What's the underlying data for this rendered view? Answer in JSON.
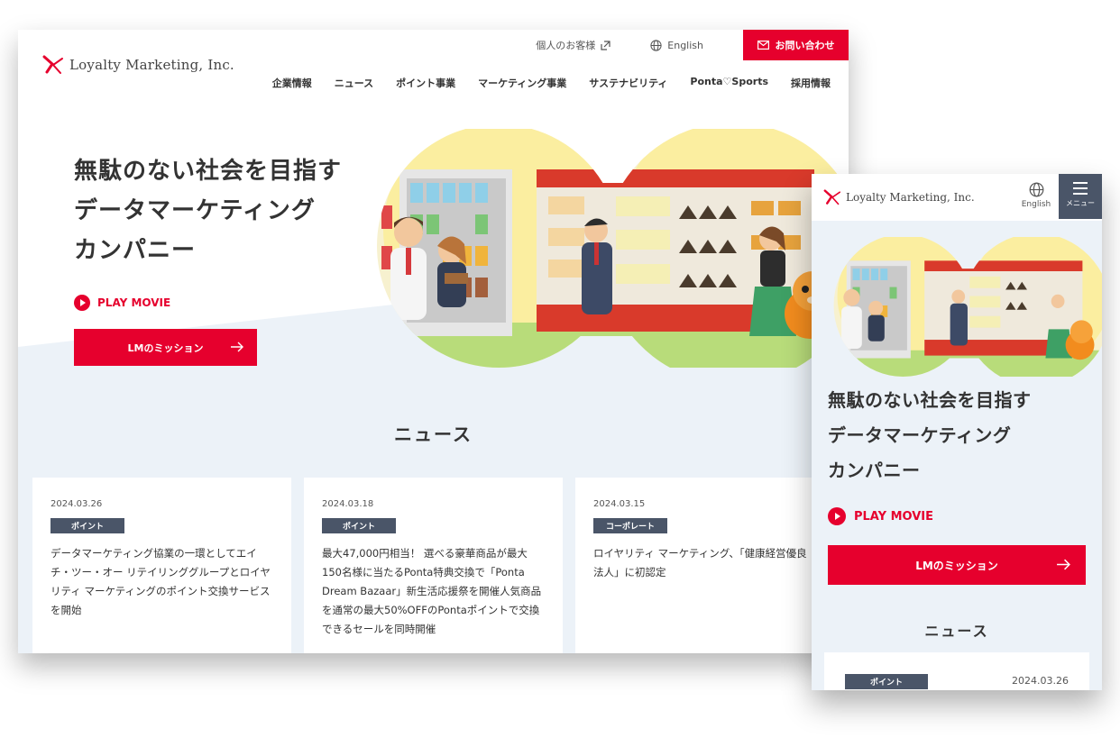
{
  "brand": {
    "name": "Loyalty Marketing, Inc.",
    "accent": "#e6002d",
    "tag_color": "#4a5568"
  },
  "desktop": {
    "utility": {
      "personal": "個人のお客様",
      "language": "English",
      "contact": "お問い合わせ"
    },
    "nav": [
      "企業情報",
      "ニュース",
      "ポイント事業",
      "マーケティング事業",
      "サステナビリティ",
      "Ponta♡Sports",
      "採用情報"
    ],
    "hero": {
      "title_lines": [
        "無駄のない社会を目指す",
        "データマーケティング",
        "カンパニー"
      ],
      "play_label": "PLAY MOVIE",
      "mission_label": "LMのミッション"
    },
    "news": {
      "title": "ニュース",
      "items": [
        {
          "date": "2024.03.26",
          "tag": "ポイント",
          "text": "データマーケティング協業の一環としてエイチ・ツー・オー リテイリンググループとロイヤリティ マーケティングのポイント交換サービスを開始"
        },
        {
          "date": "2024.03.18",
          "tag": "ポイント",
          "text": "最大47,000円相当！ 選べる豪華商品が最大150名様に当たるPonta特典交換で「Ponta Dream Bazaar」新生活応援祭を開催人気商品を通常の最大50%OFFのPontaポイントで交換できるセールを同時開催"
        },
        {
          "date": "2024.03.15",
          "tag": "コーポレート",
          "text": "ロイヤリティ マーケティング、「健康経営優良法人」に初認定"
        }
      ]
    }
  },
  "mobile": {
    "language": "English",
    "menu": "メニュー",
    "hero": {
      "title_lines": [
        "無駄のない社会を目指す",
        "データマーケティング",
        "カンパニー"
      ],
      "play_label": "PLAY MOVIE",
      "mission_label": "LMのミッション"
    },
    "news": {
      "title": "ニュース",
      "first": {
        "tag": "ポイント",
        "date": "2024.03.26"
      }
    }
  },
  "icons": [
    "logo-mark-icon",
    "external-link-icon",
    "globe-icon",
    "mail-icon",
    "play-icon",
    "arrow-right-icon",
    "hamburger-icon"
  ]
}
